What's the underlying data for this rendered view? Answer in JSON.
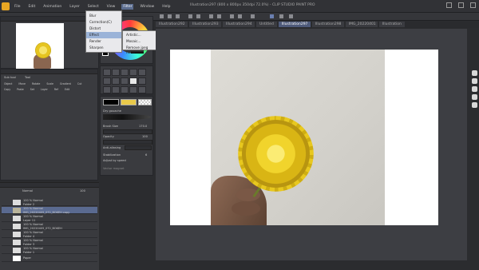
{
  "app": {
    "title": "Illustration297 (800 x 800px 350dpi 72.0%) - CLIP STUDIO PAINT PRO"
  },
  "menus": [
    "File",
    "Edit",
    "Animation",
    "Layer",
    "Select",
    "View",
    "Filter",
    "Window",
    "Help"
  ],
  "active_menu": "Filter",
  "filter_menu": {
    "items": [
      "Blur",
      "Correction(C)",
      "Distort",
      "Effect",
      "Render",
      "Sharpen"
    ],
    "highlighted": "Effect"
  },
  "effect_submenu": {
    "items": [
      "Artistic...",
      "Mosaic...",
      "Remove jpeg noise"
    ]
  },
  "tabs": [
    "Illustration292",
    "Illustration293",
    "Illustration294",
    "Untitled",
    "Illustration297",
    "Illustration298",
    "IMG_20220401",
    "Illustration"
  ],
  "current_tab": "Illustration297",
  "navigator": {
    "title": "Navigator",
    "zoom": "72.0"
  },
  "sub_tool": {
    "title": "Sub tool",
    "group": "Tool",
    "tools": [
      "Object",
      "Move",
      "Rotate",
      "Scale",
      "Gradient",
      "Cut",
      "Copy",
      "Paste",
      "Set",
      "Layer",
      "Ref",
      "Edit"
    ]
  },
  "tool_property": {
    "title": "Tool property",
    "brush_name": "Dry gouache",
    "brush_size_label": "Brush Size",
    "brush_size_value": "170.0",
    "opacity_label": "Opacity",
    "opacity_value": "100",
    "antialias_label": "Anti-aliasing",
    "stabilization_label": "Stabilization",
    "stabilization_value": "6",
    "adjust_speed_label": "Adjust by speed",
    "vector_magnet_label": "Vector magnet"
  },
  "layers": {
    "title": "Layer",
    "blend_mode": "Normal",
    "opacity": "100",
    "rows": [
      {
        "line1": "100 % Normal",
        "line2": "Folder 2",
        "selected": false
      },
      {
        "line1": "100 % Normal",
        "line2": "IMG_20220405_072_BOKEH copy",
        "selected": true
      },
      {
        "line1": "100 % Normal",
        "line2": "Layer 11",
        "selected": false
      },
      {
        "line1": "100 % Normal",
        "line2": "IMG_20220405_072_BOKEH",
        "selected": false
      },
      {
        "line1": "100 % Normal",
        "line2": "Folder 4",
        "selected": false
      },
      {
        "line1": "100 % Normal",
        "line2": "Folder 3",
        "selected": false
      },
      {
        "line1": "100 % Normal",
        "line2": "Folder 1",
        "selected": false
      },
      {
        "line1": "100 % Normal",
        "line2": "Folder 1",
        "selected": false
      },
      {
        "line1": "100 % Normal",
        "line2": "Layer 1",
        "selected": false
      },
      {
        "line1": "",
        "line2": "Paper",
        "selected": false
      }
    ]
  },
  "colors": {
    "accent": "#5b6c8e",
    "selection": "#5a6a90",
    "flower": "#f1d42c",
    "main_color": "#000000",
    "sub_color": "#e9c94a"
  },
  "icons": {
    "right_bar": [
      "camera-icon",
      "grid-icon",
      "layout-icon",
      "lock-icon",
      "gear-icon"
    ]
  }
}
